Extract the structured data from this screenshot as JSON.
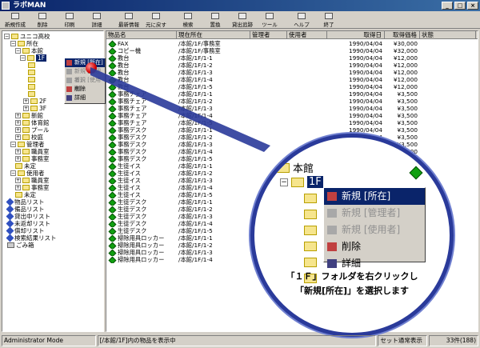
{
  "app": {
    "title": "ラボMAN"
  },
  "toolbar": [
    {
      "label": "新規作成",
      "icon": "new-icon"
    },
    {
      "label": "削除",
      "icon": "delete-icon"
    },
    {
      "label": "印刷",
      "icon": "print-icon"
    },
    {
      "label": "詳細",
      "icon": "details-icon"
    },
    {
      "label": "最新情報",
      "icon": "refresh-icon"
    },
    {
      "label": "元に戻す",
      "icon": "undo-icon"
    },
    {
      "label": "検索",
      "icon": "search-icon"
    },
    {
      "label": "置換",
      "icon": "replace-icon"
    },
    {
      "label": "貸出追跡",
      "icon": "track-icon"
    },
    {
      "label": "ツール",
      "icon": "tools-icon"
    },
    {
      "label": "ヘルプ",
      "icon": "help-icon"
    },
    {
      "label": "終了",
      "icon": "exit-icon"
    }
  ],
  "tree": [
    {
      "label": "ユニコ高校",
      "toggle": "-",
      "icon": "folder"
    },
    {
      "label": "所在",
      "toggle": "-",
      "icon": "folder"
    },
    {
      "label": "本館",
      "toggle": "-",
      "icon": "folder"
    },
    {
      "label": "1F",
      "toggle": "-",
      "icon": "folder"
    },
    {
      "label": "",
      "toggle": "",
      "icon": "folder"
    },
    {
      "label": "",
      "toggle": "",
      "icon": "folder"
    },
    {
      "label": "",
      "toggle": "",
      "icon": "folder"
    },
    {
      "label": "",
      "toggle": "",
      "icon": "folder"
    },
    {
      "label": "",
      "toggle": "",
      "icon": "folder"
    },
    {
      "label": "2F",
      "toggle": "+",
      "icon": "folder"
    },
    {
      "label": "3F",
      "toggle": "+",
      "icon": "folder"
    },
    {
      "label": "新館",
      "toggle": "+",
      "icon": "folder"
    },
    {
      "label": "体育館",
      "toggle": "+",
      "icon": "folder"
    },
    {
      "label": "プール",
      "toggle": "+",
      "icon": "folder"
    },
    {
      "label": "校庭",
      "toggle": "+",
      "icon": "folder"
    },
    {
      "label": "管理者",
      "toggle": "-",
      "icon": "folder"
    },
    {
      "label": "職員室",
      "toggle": "+",
      "icon": "folder"
    },
    {
      "label": "事務室",
      "toggle": "+",
      "icon": "folder"
    },
    {
      "label": "未定",
      "toggle": "",
      "icon": "folder"
    },
    {
      "label": "使用者",
      "toggle": "-",
      "icon": "folder"
    },
    {
      "label": "職員室",
      "toggle": "+",
      "icon": "folder"
    },
    {
      "label": "事務室",
      "toggle": "+",
      "icon": "folder"
    },
    {
      "label": "未定",
      "toggle": "",
      "icon": "folder"
    },
    {
      "label": "物品リスト",
      "toggle": "",
      "icon": "list"
    },
    {
      "label": "備品リスト",
      "toggle": "",
      "icon": "list"
    },
    {
      "label": "貸出中リスト",
      "toggle": "",
      "icon": "list"
    },
    {
      "label": "未返却リスト",
      "toggle": "",
      "icon": "list"
    },
    {
      "label": "償却リスト",
      "toggle": "",
      "icon": "list"
    },
    {
      "label": "検索結果リスト",
      "toggle": "",
      "icon": "list"
    },
    {
      "label": "ごみ箱",
      "toggle": "",
      "icon": "trash"
    }
  ],
  "list": {
    "columns": [
      "物品名",
      "現在所在",
      "管理者",
      "使用者",
      "取得日",
      "取得価格",
      "状態"
    ],
    "rows": [
      [
        "FAX",
        "/本館/1F/事務室",
        "",
        "",
        "1990/04/04",
        "¥30,000",
        ""
      ],
      [
        "コピー機",
        "/本館/1F/事務室",
        "",
        "",
        "1990/04/04",
        "¥32,000",
        ""
      ],
      [
        "教台",
        "/本館/1F/1-1",
        "",
        "",
        "1990/04/04",
        "¥12,000",
        ""
      ],
      [
        "教台",
        "/本館/1F/1-2",
        "",
        "",
        "1990/04/04",
        "¥12,000",
        ""
      ],
      [
        "教台",
        "/本館/1F/1-3",
        "",
        "",
        "1990/04/04",
        "¥12,000",
        ""
      ],
      [
        "教台",
        "/本館/1F/1-4",
        "",
        "",
        "1990/04/04",
        "¥12,000",
        ""
      ],
      [
        "教台",
        "/本館/1F/1-5",
        "",
        "",
        "1990/04/04",
        "¥12,000",
        ""
      ],
      [
        "事務チェア",
        "/本館/1F/1-1",
        "",
        "",
        "1990/04/04",
        "¥3,500",
        ""
      ],
      [
        "事務チェア",
        "/本館/1F/1-2",
        "",
        "",
        "1990/04/04",
        "¥3,500",
        ""
      ],
      [
        "事務チェア",
        "/本館/1F/1-3",
        "",
        "",
        "1990/04/04",
        "¥3,500",
        ""
      ],
      [
        "事務チェア",
        "/本館/1F/1-4",
        "",
        "",
        "1990/04/04",
        "¥3,500",
        ""
      ],
      [
        "事務チェア",
        "/本館/1F/1-5",
        "",
        "",
        "1990/04/04",
        "¥3,500",
        ""
      ],
      [
        "事務デスク",
        "/本館/1F/1-1",
        "",
        "",
        "1990/04/04",
        "¥3,500",
        ""
      ],
      [
        "事務デスク",
        "/本館/1F/1-2",
        "",
        "",
        "1990/04/04",
        "¥3,500",
        ""
      ],
      [
        "事務デスク",
        "/本館/1F/1-3",
        "",
        "",
        "1990/04/04",
        "¥3,500",
        ""
      ],
      [
        "事務デスク",
        "/本館/1F/1-4",
        "",
        "",
        "1990/04/04",
        "¥3,500",
        ""
      ],
      [
        "事務デスク",
        "/本館/1F/1-5",
        "",
        "",
        "1990/04/04",
        "¥3,500",
        ""
      ],
      [
        "生徒イス",
        "/本館/1F/1-1",
        "",
        "",
        "1990/04/04",
        "¥3,500",
        ""
      ],
      [
        "生徒イス",
        "/本館/1F/1-2",
        "",
        "",
        "",
        "",
        ""
      ],
      [
        "生徒イス",
        "/本館/1F/1-3",
        "",
        "",
        "",
        "",
        ""
      ],
      [
        "生徒イス",
        "/本館/1F/1-4",
        "",
        "",
        "",
        "",
        ""
      ],
      [
        "生徒イス",
        "/本館/1F/1-5",
        "",
        "",
        "",
        "",
        ""
      ],
      [
        "生徒デスク",
        "/本館/1F/1-1",
        "",
        "",
        "",
        "",
        ""
      ],
      [
        "生徒デスク",
        "/本館/1F/1-2",
        "",
        "",
        "",
        "",
        ""
      ],
      [
        "生徒デスク",
        "/本館/1F/1-3",
        "",
        "",
        "",
        "",
        ""
      ],
      [
        "生徒デスク",
        "/本館/1F/1-4",
        "",
        "",
        "",
        "",
        ""
      ],
      [
        "生徒デスク",
        "/本館/1F/1-5",
        "",
        "",
        "",
        "",
        ""
      ],
      [
        "掃除用具ロッカー",
        "/本館/1F/1-1",
        "",
        "",
        "",
        "",
        ""
      ],
      [
        "掃除用具ロッカー",
        "/本館/1F/1-2",
        "",
        "",
        "",
        "",
        ""
      ],
      [
        "掃除用具ロッカー",
        "/本館/1F/1-3",
        "",
        "",
        "",
        "",
        ""
      ],
      [
        "掃除用具ロッカー",
        "/本館/1F/1-4",
        "",
        "",
        "",
        "",
        ""
      ]
    ]
  },
  "context_menu": [
    {
      "label": "新規 [所在]",
      "state": "selected"
    },
    {
      "label": "新規 [管理者]",
      "state": "disabled"
    },
    {
      "label": "新規 [使用者]",
      "state": "disabled"
    },
    {
      "label": "削除",
      "state": "normal"
    },
    {
      "label": "詳細",
      "state": "normal"
    }
  ],
  "zoom": {
    "tree": {
      "parent": "本館",
      "node": "1F"
    },
    "menu": [
      {
        "label": "新規 [所在]",
        "state": "selected"
      },
      {
        "label": "新規 [管理者]",
        "state": "disabled"
      },
      {
        "label": "新規 [使用者]",
        "state": "disabled"
      },
      {
        "label": "削除",
        "state": "normal"
      },
      {
        "label": "詳細",
        "state": "normal"
      }
    ],
    "caption_line1": "「１Ｆ」フォルダを右クリックし",
    "caption_line2": "「新規[所在]」を選択します"
  },
  "status": {
    "mode": "Administrator Mode",
    "message": "[/本館/1F]内の物品を表示中",
    "setting": "セット通常表示",
    "count": "33件(188)"
  },
  "colors": {
    "title_bar": "#0a246a",
    "selection": "#0a246a",
    "lens_border": "#2a3a9a",
    "item_icon": "#10a010"
  }
}
